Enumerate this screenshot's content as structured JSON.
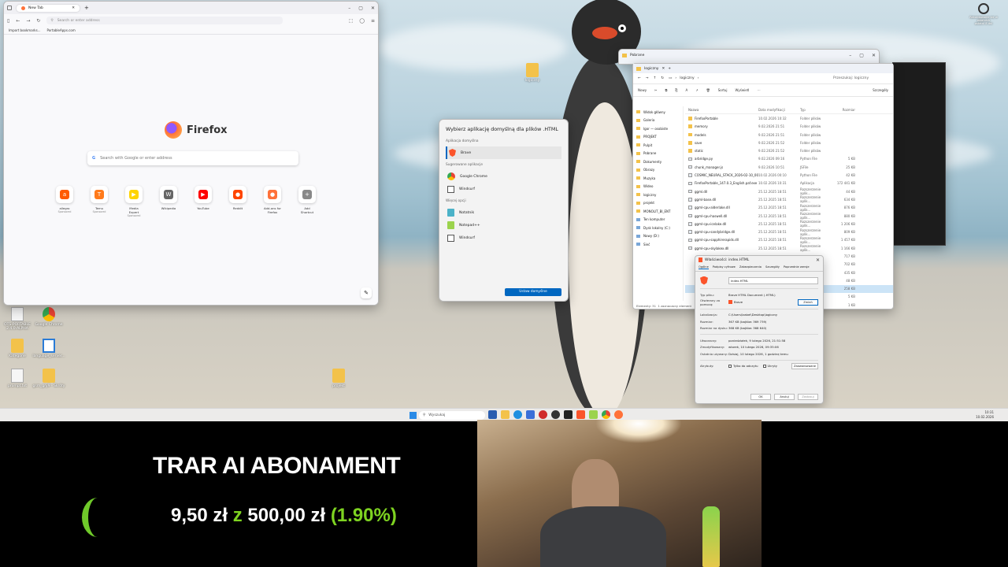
{
  "desktop": {
    "top_right_icon_label": "Rekordowanie się w ostatnich\nostatni 8 dni",
    "icons": [
      {
        "name": "portable-icon",
        "label": "OTS-PORTABLE\n2.4.0-ALPHA"
      },
      {
        "name": "google-chrome-icon",
        "label": "Google Chrome"
      },
      {
        "name": "folder-icon",
        "label": "Kategorie"
      },
      {
        "name": "language-icon",
        "label": "language_server..."
      },
      {
        "name": "file-icon",
        "label": "prompt.txt"
      },
      {
        "name": "gsm-folder-icon",
        "label": "gsm_gry9 - Skróty"
      },
      {
        "name": "logiczny-folder-icon",
        "label": "logiczny"
      },
      {
        "name": "projekt-folder-icon",
        "label": "projekt"
      }
    ]
  },
  "firefox": {
    "tab_title": "New Tab",
    "url_placeholder": "Search or enter address",
    "bookmarks": [
      "Import bookmarks...",
      "PortableApps.com"
    ],
    "brand": "Firefox",
    "search_placeholder": "Search with Google or enter address",
    "shortcuts": [
      {
        "label": "allegro",
        "sub": "Sponsored",
        "color": "#ff5a00",
        "glyph": "a"
      },
      {
        "label": "Temu",
        "sub": "Sponsored",
        "color": "#ff7a1a",
        "glyph": "T"
      },
      {
        "label": "Media Expert",
        "sub": "Sponsored",
        "color": "#ffd400",
        "glyph": "▶"
      },
      {
        "label": "Wikipedia",
        "sub": "",
        "color": "#666666",
        "glyph": "W"
      },
      {
        "label": "YouTube",
        "sub": "",
        "color": "#ff0000",
        "glyph": "▶"
      },
      {
        "label": "Reddit",
        "sub": "",
        "color": "#ff4500",
        "glyph": "●"
      },
      {
        "label": "Add-ons for Firefox",
        "sub": "",
        "color": "#ff7139",
        "glyph": "●"
      },
      {
        "label": "Add Shortcut",
        "sub": "",
        "color": "#888888",
        "glyph": "+"
      }
    ]
  },
  "dialog": {
    "title": "Wybierz aplikację domyślną dla plików .HTML",
    "default_section": "Aplikacja domyślna",
    "default_app": "Brave",
    "suggested_section": "Sugerowane aplikacje",
    "suggested_apps": [
      "Google Chrome",
      "Windsurf"
    ],
    "more_section": "Więcej opcji",
    "more_apps": [
      "Notatnik",
      "Notepad++",
      "Windsurf"
    ],
    "button": "Ustaw domyślne"
  },
  "explorer_back": {
    "title": "Pobrane"
  },
  "explorer": {
    "tab_title": "logiczny",
    "breadcrumb": "logiczny",
    "search_placeholder": "Przeszukaj: logiczny",
    "commands": [
      "Nowy",
      "Sortuj",
      "Wyświetl",
      "Szczegóły"
    ],
    "nav": [
      "Widok główny",
      "Galeria",
      "Igor — osobiste",
      "PROJEKT",
      "Pulpit",
      "Pobrane",
      "Dokumenty",
      "Obrazy",
      "Muzyka",
      "Wideo",
      "logiczny",
      "projekt",
      "MONOLIT_BI_ENT",
      "Ten komputer",
      "Dysk lokalny (C:)",
      "Nowy (D:)",
      "Sieć"
    ],
    "headers": [
      "Nazwa",
      "Data modyfikacji",
      "Typ",
      "Rozmiar"
    ],
    "rows": [
      [
        "FirefoxPortable",
        "10.02.2026 10:32",
        "Folder plików",
        ""
      ],
      [
        "memory",
        "9.02.2026 21:51",
        "Folder plików",
        ""
      ],
      [
        "models",
        "9.02.2026 21:51",
        "Folder plików",
        ""
      ],
      [
        "save",
        "9.02.2026 21:52",
        "Folder plików",
        ""
      ],
      [
        "static",
        "9.02.2026 21:52",
        "Folder plików",
        ""
      ],
      [
        "arbridge.py",
        "9.02.2026 09:16",
        "Python File",
        "5 KB"
      ],
      [
        "chunk_manager.js",
        "9.02.2026 10:51",
        "JSFile",
        "25 KB"
      ],
      [
        "COSMIC_NEURAL_STACK_2026-02-10_00...",
        "10.02.2026 00:10",
        "Python File",
        "42 KB"
      ],
      [
        "FirefoxPortable_147.0.3_English.paf.exe",
        "10.02.2026 10:31",
        "Aplikacja",
        "172 441 KB"
      ],
      [
        "ggml.dll",
        "25.12.2025 18:51",
        "Rozszerzenie aplik...",
        "44 KB"
      ],
      [
        "ggml-base.dll",
        "25.12.2025 18:51",
        "Rozszerzenie aplik...",
        "634 KB"
      ],
      [
        "ggml-cpu-alderlake.dll",
        "25.12.2025 18:51",
        "Rozszerzenie aplik...",
        "876 KB"
      ],
      [
        "ggml-cpu-haswell.dll",
        "25.12.2025 18:51",
        "Rozszerzenie aplik...",
        "880 KB"
      ],
      [
        "ggml-cpu-icelake.dll",
        "25.12.2025 18:51",
        "Rozszerzenie aplik...",
        "1 206 KB"
      ],
      [
        "ggml-cpu-sandybridge.dll",
        "25.12.2025 18:51",
        "Rozszerzenie aplik...",
        "809 KB"
      ],
      [
        "ggml-cpu-sapphirerapids.dll",
        "25.12.2025 18:51",
        "Rozszerzenie aplik...",
        "1 457 KB"
      ],
      [
        "ggml-cpu-skylakex.dll",
        "25.12.2025 18:51",
        "Rozszerzenie aplik...",
        "1 166 KB"
      ],
      [
        "",
        "",
        "",
        "717 KB"
      ],
      [
        "",
        "",
        "",
        "702 KB"
      ],
      [
        "",
        "",
        "",
        "435 KB"
      ],
      [
        "",
        "",
        "",
        "48 KB"
      ],
      [
        "",
        "",
        "",
        "258 KB"
      ],
      [
        "",
        "",
        "",
        "5 KB"
      ],
      [
        "",
        "",
        "",
        "1 KB"
      ]
    ],
    "status": [
      "Elementy: 31",
      "1 zaznaczony element"
    ]
  },
  "properties": {
    "title": "Właściwości: index.HTML",
    "tabs": [
      "Ogólne",
      "Podpisy cyfrowe",
      "Zabezpieczenia",
      "Szczegóły",
      "Poprzednie wersje"
    ],
    "filename": "index.HTML",
    "type_label": "Typ pliku:",
    "type_value": "Brave HTML Document (.HTML)",
    "opens_label": "Otwierany za pomocą:",
    "opens_value": "Brave",
    "change_button": "Zmień",
    "location_label": "Lokalizacja:",
    "location_value": "C:\\Users\\Izabel\\Desktop\\logiczny",
    "size_label": "Rozmiar:",
    "size_value": "367 KB (bajtów: 369 739)",
    "disk_label": "Rozmiar na dysku:",
    "disk_value": "368 KB (bajtów: 368 640)",
    "created_label": "Utworzony:",
    "created_value": "poniedziałek, 9 lutego 2026, 21:51:58",
    "modified_label": "Zmodyfikowany:",
    "modified_value": "wtorek, 10 lutego 2026, 09:35:06",
    "accessed_label": "Ostatnio używany:",
    "accessed_value": "Dzisiaj, 10 lutego 2026, 1 godzinę temu",
    "attrs_label": "Atrybuty:",
    "readonly": "Tylko do odczytu",
    "hidden": "Ukryty",
    "advanced": "Zaawansowane",
    "ok": "OK",
    "cancel": "Anuluj",
    "apply": "Zastosuj"
  },
  "taskbar": {
    "search_placeholder": "Wyszukaj",
    "time": "10:31",
    "date": "10.02.2026"
  },
  "overlay": {
    "title": "TRAR AI ABONAMENT",
    "amount": "9,50 zł",
    "z": "z",
    "goal": "500,00 zł",
    "percent": "(1.90%)",
    "progress_fraction": 0.019
  },
  "colors": {
    "accent": "#0067c0",
    "green": "#7ed321"
  }
}
